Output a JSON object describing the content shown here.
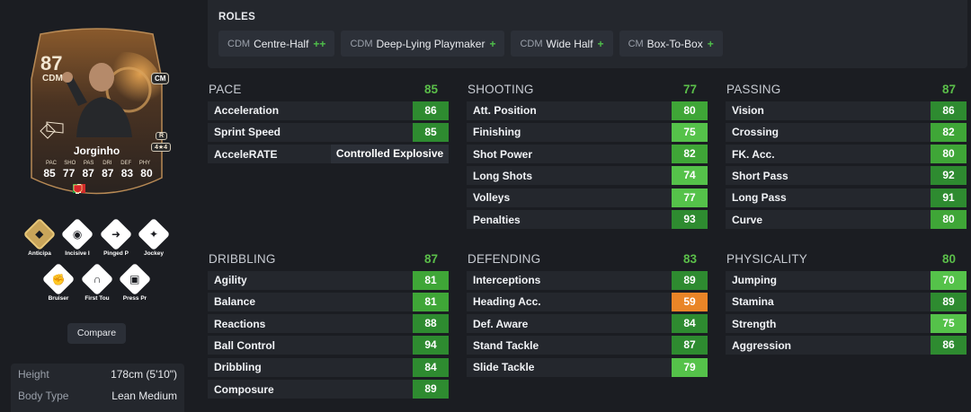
{
  "card": {
    "rating": "87",
    "position": "CDM",
    "alt_position": "CM",
    "name": "Jorginho",
    "weak_foot": "R",
    "skill_moves": "4★4",
    "stat_labels": [
      "PAC",
      "SHO",
      "PAS",
      "DRI",
      "DEF",
      "PHY"
    ],
    "stat_values": [
      "85",
      "77",
      "87",
      "87",
      "83",
      "80"
    ],
    "colors": {
      "frame": "#6b4a2a",
      "glow": "#c9803a",
      "dark": "#2a2320"
    }
  },
  "playstyles": [
    {
      "label": "Anticipa",
      "icon": "raccoon-icon",
      "tier": "plus"
    },
    {
      "label": "Incisive I",
      "icon": "pin-icon",
      "tier": "base"
    },
    {
      "label": "Pinged P",
      "icon": "arrow-pass-icon",
      "tier": "base"
    },
    {
      "label": "Jockey",
      "icon": "jockey-icon",
      "tier": "base"
    },
    {
      "label": "Bruiser",
      "icon": "flex-arm-icon",
      "tier": "base"
    },
    {
      "label": "First Tou",
      "icon": "magnet-icon",
      "tier": "base"
    },
    {
      "label": "Press Pr",
      "icon": "press-icon",
      "tier": "base"
    }
  ],
  "compare_label": "Compare",
  "bio": [
    {
      "key": "Height",
      "value": "178cm (5'10\")"
    },
    {
      "key": "Body Type",
      "value": "Lean Medium"
    }
  ],
  "roles": {
    "title": "ROLES",
    "items": [
      {
        "pos": "CDM",
        "role": "Centre-Half",
        "plus": "++"
      },
      {
        "pos": "CDM",
        "role": "Deep-Lying Playmaker",
        "plus": "+"
      },
      {
        "pos": "CDM",
        "role": "Wide Half",
        "plus": "+"
      },
      {
        "pos": "CM",
        "role": "Box-To-Box",
        "plus": "+"
      }
    ]
  },
  "rating_colors": {
    "elite": "#2e8b30",
    "high": "#3fa637",
    "good": "#55c24a",
    "mid": "#e98527"
  },
  "groups": [
    {
      "name": "PACE",
      "value": "85",
      "stats": [
        {
          "name": "Acceleration",
          "value": "86"
        },
        {
          "name": "Sprint Speed",
          "value": "85"
        },
        {
          "name": "AcceleRATE",
          "value": "Controlled Explosive",
          "text": true
        }
      ]
    },
    {
      "name": "SHOOTING",
      "value": "77",
      "stats": [
        {
          "name": "Att. Position",
          "value": "80"
        },
        {
          "name": "Finishing",
          "value": "75"
        },
        {
          "name": "Shot Power",
          "value": "82"
        },
        {
          "name": "Long Shots",
          "value": "74"
        },
        {
          "name": "Volleys",
          "value": "77"
        },
        {
          "name": "Penalties",
          "value": "93"
        }
      ]
    },
    {
      "name": "PASSING",
      "value": "87",
      "stats": [
        {
          "name": "Vision",
          "value": "86"
        },
        {
          "name": "Crossing",
          "value": "82"
        },
        {
          "name": "FK. Acc.",
          "value": "80"
        },
        {
          "name": "Short Pass",
          "value": "92"
        },
        {
          "name": "Long Pass",
          "value": "91"
        },
        {
          "name": "Curve",
          "value": "80"
        }
      ]
    },
    {
      "name": "DRIBBLING",
      "value": "87",
      "stats": [
        {
          "name": "Agility",
          "value": "81"
        },
        {
          "name": "Balance",
          "value": "81"
        },
        {
          "name": "Reactions",
          "value": "88"
        },
        {
          "name": "Ball Control",
          "value": "94"
        },
        {
          "name": "Dribbling",
          "value": "84"
        },
        {
          "name": "Composure",
          "value": "89"
        }
      ]
    },
    {
      "name": "DEFENDING",
      "value": "83",
      "stats": [
        {
          "name": "Interceptions",
          "value": "89"
        },
        {
          "name": "Heading Acc.",
          "value": "59"
        },
        {
          "name": "Def. Aware",
          "value": "84"
        },
        {
          "name": "Stand Tackle",
          "value": "87"
        },
        {
          "name": "Slide Tackle",
          "value": "79"
        }
      ]
    },
    {
      "name": "PHYSICALITY",
      "value": "80",
      "stats": [
        {
          "name": "Jumping",
          "value": "70"
        },
        {
          "name": "Stamina",
          "value": "89"
        },
        {
          "name": "Strength",
          "value": "75"
        },
        {
          "name": "Aggression",
          "value": "86"
        }
      ]
    }
  ]
}
